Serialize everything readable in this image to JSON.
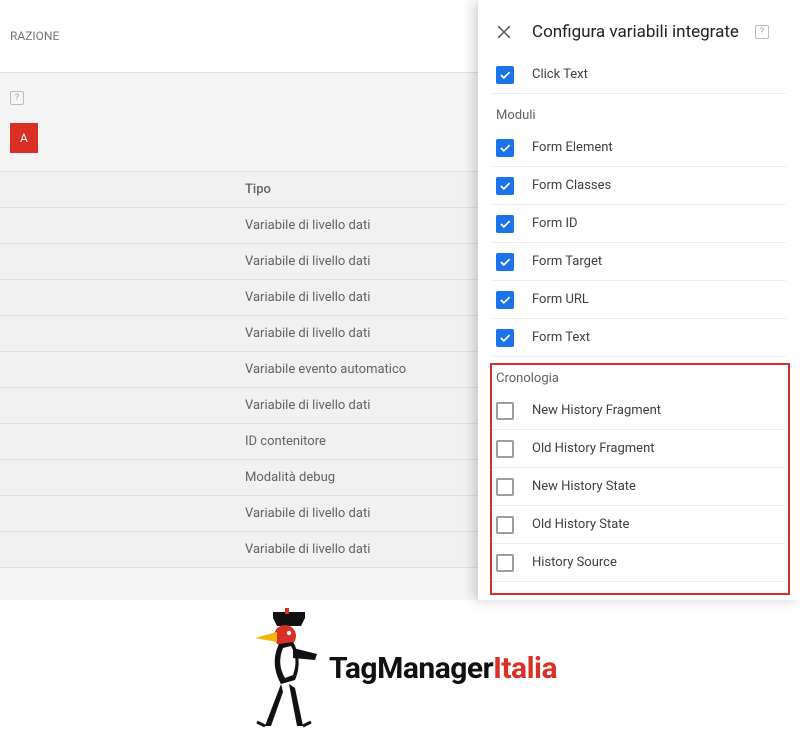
{
  "underlay": {
    "topText": "RAZIONE",
    "buttonTail": "A",
    "tableHeader": "Tipo",
    "rows": [
      "Variabile di livello dati",
      "Variabile di livello dati",
      "Variabile di livello dati",
      "Variabile di livello dati",
      "Variabile evento automatico",
      "Variabile di livello dati",
      "ID contenitore",
      "Modalità debug",
      "Variabile di livello dati",
      "Variabile di livello dati"
    ]
  },
  "panel": {
    "title": "Configura variabili integrate",
    "help": "?",
    "sections": [
      {
        "label": null,
        "items": [
          {
            "label": "Click Text",
            "checked": true
          }
        ]
      },
      {
        "label": "Moduli",
        "items": [
          {
            "label": "Form Element",
            "checked": true
          },
          {
            "label": "Form Classes",
            "checked": true
          },
          {
            "label": "Form ID",
            "checked": true
          },
          {
            "label": "Form Target",
            "checked": true
          },
          {
            "label": "Form URL",
            "checked": true
          },
          {
            "label": "Form Text",
            "checked": true
          }
        ]
      },
      {
        "label": "Cronologia",
        "items": [
          {
            "label": "New History Fragment",
            "checked": false
          },
          {
            "label": "Old History Fragment",
            "checked": false
          },
          {
            "label": "New History State",
            "checked": false
          },
          {
            "label": "Old History State",
            "checked": false
          },
          {
            "label": "History Source",
            "checked": false
          }
        ]
      }
    ]
  },
  "brand": {
    "part1": "TagManager",
    "part2": "Italia"
  }
}
